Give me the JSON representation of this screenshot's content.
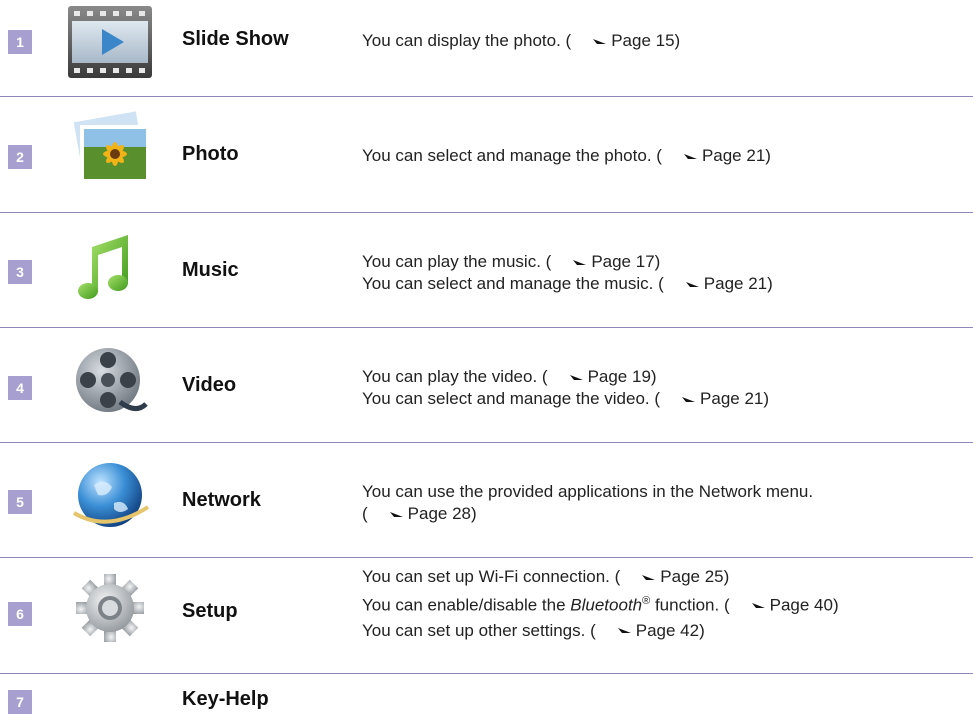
{
  "rows": [
    {
      "number": "1",
      "icon": "slide-show-filmstrip-icon",
      "label": "Slide Show",
      "lines": [
        {
          "before": "You can display the photo. (",
          "page": "Page 15)"
        }
      ]
    },
    {
      "number": "2",
      "icon": "photo-sunflower-icon",
      "label": "Photo",
      "lines": [
        {
          "before": "You can select and manage the photo. (",
          "page": "Page 21)"
        }
      ]
    },
    {
      "number": "3",
      "icon": "music-note-icon",
      "label": "Music",
      "lines": [
        {
          "before": "You can play the music. (",
          "page": "Page 17)"
        },
        {
          "before": "You can select and manage the music. (",
          "page": "Page 21)"
        }
      ]
    },
    {
      "number": "4",
      "icon": "video-film-reel-icon",
      "label": "Video",
      "lines": [
        {
          "before": "You can play the video. (",
          "page": "Page 19)"
        },
        {
          "before": "You can select and manage the video. (",
          "page": "Page 21)"
        }
      ]
    },
    {
      "number": "5",
      "icon": "network-globe-icon",
      "label": "Network",
      "lines": [
        {
          "text": "You can use the provided applications in the Network menu."
        },
        {
          "before": "(",
          "page": "Page 28)"
        }
      ]
    },
    {
      "number": "6",
      "icon": "setup-gear-icon",
      "label": "Setup",
      "lines": [
        {
          "before": "You can set up Wi-Fi connection. (",
          "page": "Page 25)"
        },
        {
          "pre": "You can enable/disable the ",
          "italic": "Bluetooth",
          "sup": "®",
          "post": " function. (",
          "page": "Page 40)"
        },
        {
          "before": "You can set up other settings. (",
          "page": "Page 42)"
        }
      ]
    },
    {
      "number": "7",
      "label": "Key-Help"
    }
  ],
  "colors": {
    "accent": "#a69fd0",
    "separator": "#8d86b6"
  }
}
